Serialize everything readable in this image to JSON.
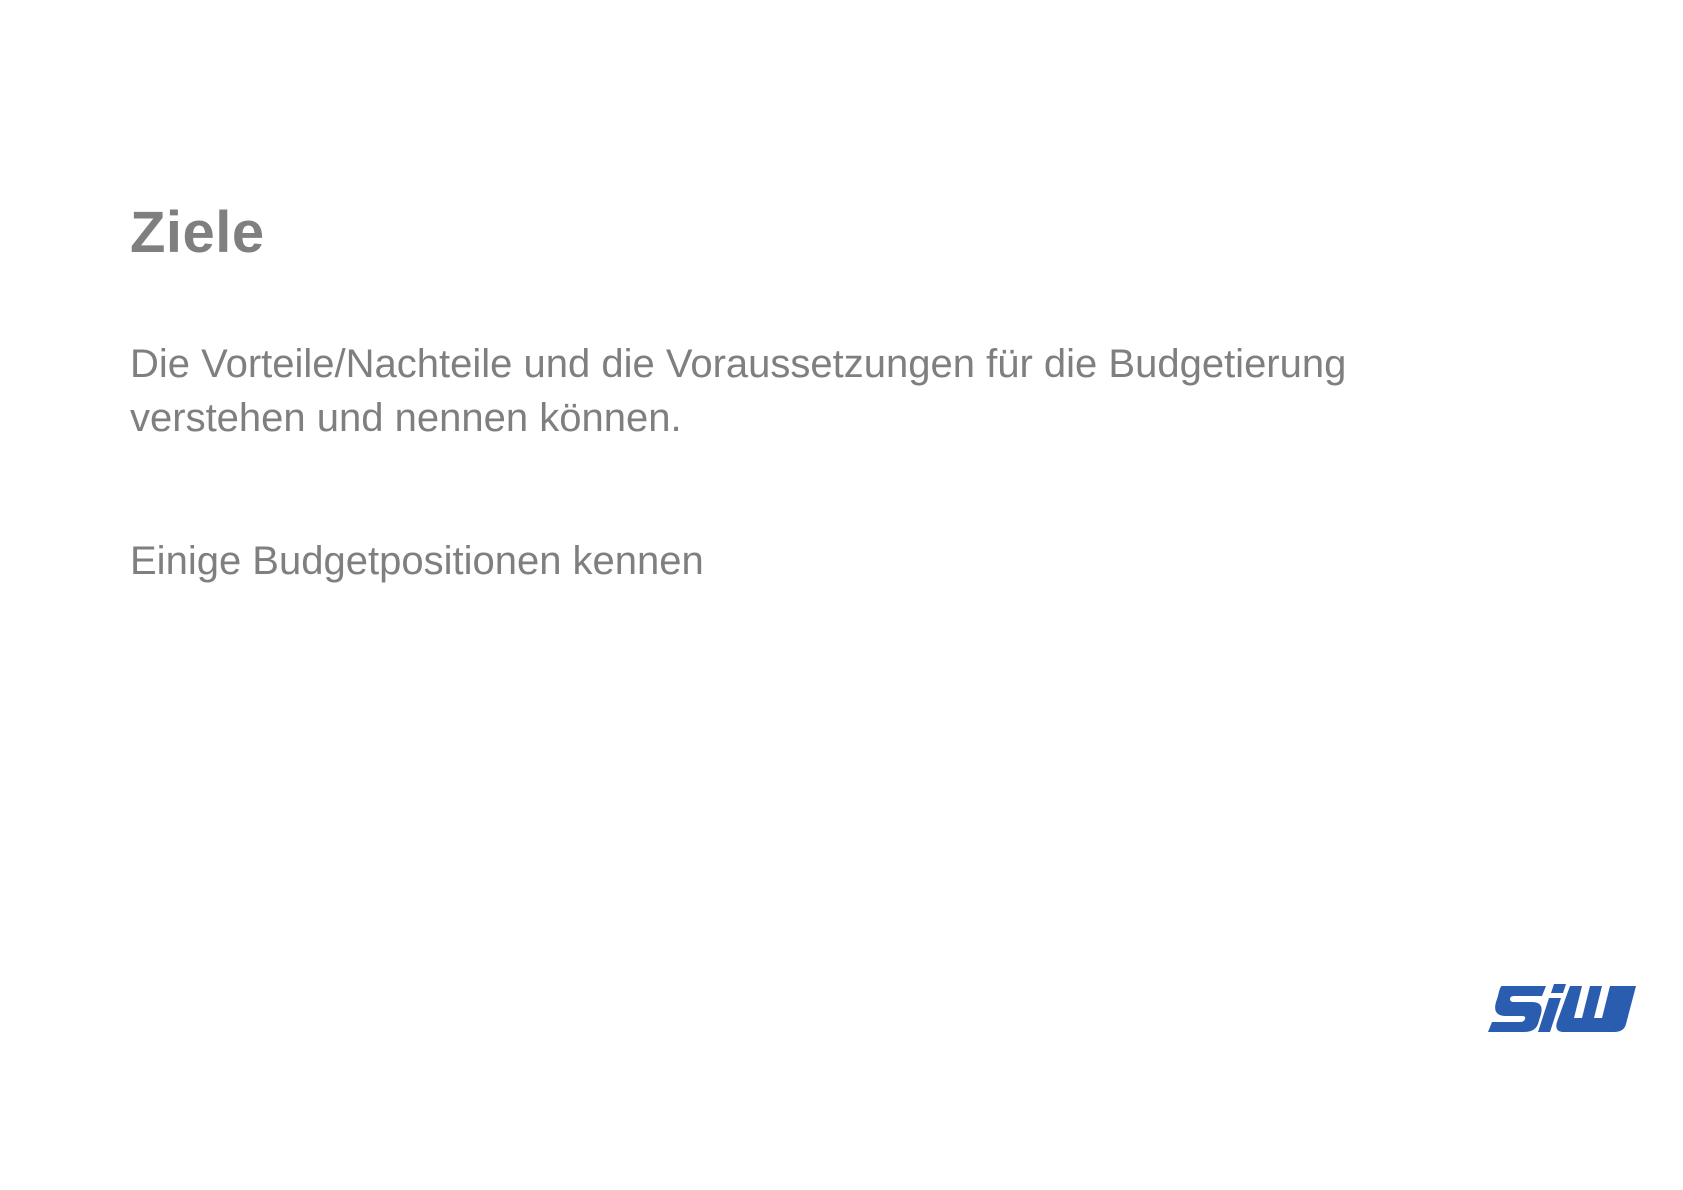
{
  "slide": {
    "title": "Ziele",
    "goals": [
      {
        "line1": "Die Vorteile/Nachteile und die Voraussetzungen für die Budgetierung",
        "line2": "verstehen und nennen können."
      },
      {
        "line1": "Einige Budgetpositionen kennen"
      }
    ]
  },
  "logo": {
    "name": "siw-logo",
    "text": "SiW",
    "color": "#2a5db0"
  },
  "colors": {
    "text": "#7f7f7f",
    "background": "#ffffff"
  }
}
